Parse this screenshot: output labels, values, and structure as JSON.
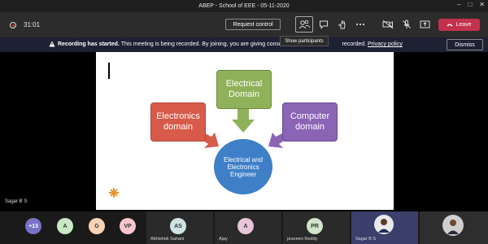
{
  "window": {
    "title": "ABEP - School of EEE - 05-11-2020",
    "controls": [
      "–",
      "□",
      "✕"
    ]
  },
  "meeting": {
    "timer": "31:01"
  },
  "toolbar": {
    "request_control_label": "Request control",
    "leave_label": "Leave"
  },
  "tooltip": {
    "text": "Show participants"
  },
  "banner": {
    "title": "Recording has started.",
    "body": "This meeting is being recorded. By joining, you are giving consent",
    "body_tail": "recorded.",
    "link": "Privacy policy",
    "dismiss_label": "Dismiss"
  },
  "slide": {
    "nodes": {
      "electrical": "Electrical Domain",
      "electronics": "Electronics domain",
      "computer": "Computer domain",
      "engineer": "Electrical and Electronics Engineer"
    }
  },
  "presenter": {
    "name": "Sagar B S"
  },
  "participants": {
    "overflow_badge": "+13",
    "avatars": [
      {
        "initial": "A",
        "color": "#c9e7c4"
      },
      {
        "initial": "G",
        "color": "#f9d3b5"
      },
      {
        "initial": "VP",
        "color": "#f7c7cd"
      }
    ],
    "tiles": [
      {
        "initials": "AS",
        "name": "Abhishek Sahani",
        "color": "#d0e3e2"
      },
      {
        "initials": "A",
        "name": "Ajay",
        "color": "#e7c4d7"
      },
      {
        "initials": "PR",
        "name": "praveen Reddy",
        "color": "#cfe4c8"
      },
      {
        "initials": "",
        "name": "Sagar B S",
        "color": "#3b3f6a"
      },
      {
        "initials": "",
        "name": "",
        "color": "#2e2e2e"
      }
    ]
  },
  "colors": {
    "leave": "#c4314b",
    "banner": "#1e2034",
    "toolbar": "#2d2c2c"
  }
}
